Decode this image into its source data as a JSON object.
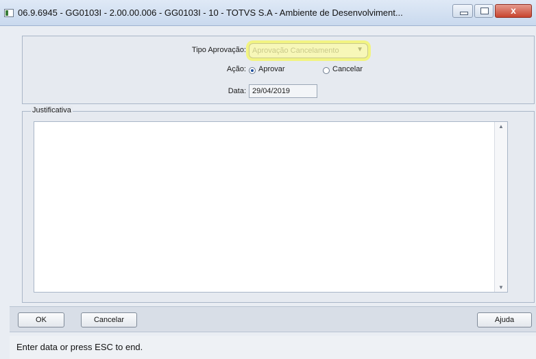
{
  "window": {
    "title": "06.9.6945 - GG0103I - 2.00.00.006 - GG0103I - 10 - TOTVS S.A - Ambiente de Desenvolviment...",
    "close_label": "x"
  },
  "form": {
    "tipo_aprovacao_label": "Tipo Aprovação:",
    "tipo_aprovacao_value": "Aprovação Cancelamento",
    "dropdown_arrow": "▼",
    "acao_label": "Ação:",
    "acao_options": [
      "Aprovar",
      "Cancelar"
    ],
    "acao_selected": "Aprovar",
    "data_label": "Data:",
    "data_value": "29/04/2019"
  },
  "justificativa": {
    "label": "Justificativa",
    "value": "",
    "scroll_up": "▲",
    "scroll_down": "▼"
  },
  "buttons": {
    "ok": "OK",
    "cancelar": "Cancelar",
    "ajuda": "Ajuda"
  },
  "status": {
    "text": "Enter data or press ESC to end."
  },
  "colors": {
    "highlight": "#f3f66e",
    "titlebar": "#c9d9ee"
  }
}
